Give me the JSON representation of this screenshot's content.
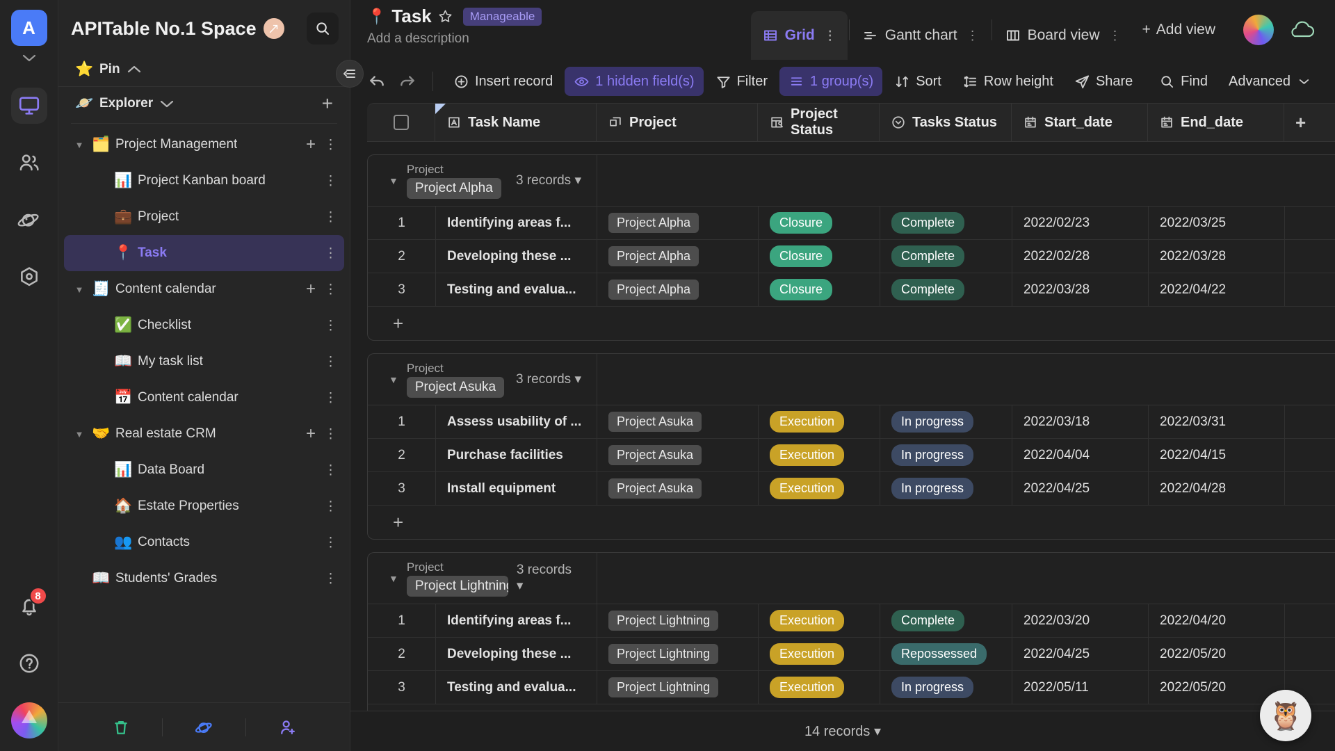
{
  "rail": {
    "workspace_initial": "A",
    "items": [
      {
        "name": "workbench",
        "icon": "monitor-icon",
        "active": true
      },
      {
        "name": "members",
        "icon": "people-icon",
        "active": false
      },
      {
        "name": "template",
        "icon": "planet-icon",
        "active": false
      },
      {
        "name": "widget-center",
        "icon": "hexagon-icon",
        "active": false
      }
    ],
    "notification_count": "8",
    "help_label": "?"
  },
  "sidebar": {
    "space_name": "APITable No.1 Space",
    "space_badge_icon": "pencil-badge-icon",
    "search_icon": "search-icon",
    "pin": {
      "label": "Pin",
      "emoji": "⭐",
      "caret": "chevron-up-icon"
    },
    "explorer": {
      "label": "Explorer",
      "emoji": "🪐",
      "caret": "chevron-down-icon",
      "add_label": "+"
    },
    "tree": [
      {
        "label": "Project Management",
        "emoji": "🗂️",
        "level": 1,
        "expanded": true,
        "selected": false,
        "has_add": true
      },
      {
        "label": "Project Kanban board",
        "emoji": "📊",
        "level": 2,
        "expanded": false,
        "selected": false,
        "has_add": false
      },
      {
        "label": "Project",
        "emoji": "💼",
        "level": 2,
        "expanded": false,
        "selected": false,
        "has_add": false
      },
      {
        "label": "Task",
        "emoji": "📍",
        "level": 2,
        "expanded": false,
        "selected": true,
        "has_add": false
      },
      {
        "label": "Content calendar",
        "emoji": "🧾",
        "level": 1,
        "expanded": true,
        "selected": false,
        "has_add": true
      },
      {
        "label": "Checklist",
        "emoji": "✅",
        "level": 2,
        "expanded": false,
        "selected": false,
        "has_add": false
      },
      {
        "label": "My task list",
        "emoji": "📖",
        "level": 2,
        "expanded": false,
        "selected": false,
        "has_add": false
      },
      {
        "label": "Content calendar",
        "emoji": "📅",
        "level": 2,
        "expanded": false,
        "selected": false,
        "has_add": false
      },
      {
        "label": "Real estate CRM",
        "emoji": "🤝",
        "level": 1,
        "expanded": true,
        "selected": false,
        "has_add": true
      },
      {
        "label": "Data Board",
        "emoji": "📊",
        "level": 2,
        "expanded": false,
        "selected": false,
        "has_add": false
      },
      {
        "label": "Estate Properties",
        "emoji": "🏠",
        "level": 2,
        "expanded": false,
        "selected": false,
        "has_add": false
      },
      {
        "label": "Contacts",
        "emoji": "👥",
        "level": 2,
        "expanded": false,
        "selected": false,
        "has_add": false
      },
      {
        "label": "Students' Grades",
        "emoji": "📖",
        "level": 1,
        "expanded": false,
        "selected": false,
        "has_add": false
      }
    ],
    "footer": [
      {
        "name": "trash-icon",
        "color": "#35c08a"
      },
      {
        "name": "template-planet-icon",
        "color": "#4a7bf7"
      },
      {
        "name": "invite-user-icon",
        "color": "#8b7bf3"
      }
    ],
    "collapse_icon": "collapse-sidebar-icon"
  },
  "header": {
    "datasheet_emoji": "📍",
    "datasheet_name": "Task",
    "star_icon": "star-outline-icon",
    "permission_badge": "Manageable",
    "description_placeholder": "Add a description",
    "views": [
      {
        "label": "Grid",
        "icon": "grid-view-icon",
        "active": true,
        "has_menu": true
      },
      {
        "label": "Gantt chart",
        "icon": "gantt-view-icon",
        "active": false,
        "has_menu": true
      },
      {
        "label": "Board view",
        "icon": "board-view-icon",
        "active": false,
        "has_menu": true
      }
    ],
    "add_view_label": "Add view",
    "add_view_icon": "plus-icon",
    "avatar_name": "user-avatar",
    "cloud_icon": "cloud-sync-icon"
  },
  "toolbar": {
    "undo_icon": "undo-icon",
    "redo_icon": "redo-icon",
    "buttons": [
      {
        "label": "Insert record",
        "icon": "plus-circle-icon",
        "accent": false
      },
      {
        "label": "1 hidden field(s)",
        "icon": "eye-icon",
        "accent": true
      },
      {
        "label": "Filter",
        "icon": "filter-icon",
        "accent": false
      },
      {
        "label": "1 group(s)",
        "icon": "group-icon",
        "accent": true
      },
      {
        "label": "Sort",
        "icon": "sort-icon",
        "accent": false
      },
      {
        "label": "Row height",
        "icon": "row-height-icon",
        "accent": false
      },
      {
        "label": "Share",
        "icon": "share-icon",
        "accent": false
      }
    ],
    "right_buttons": [
      {
        "label": "Find",
        "icon": "search-icon"
      },
      {
        "label": "Advanced",
        "icon": "chevron-down-icon"
      }
    ]
  },
  "grid": {
    "columns": [
      {
        "label": "Task Name",
        "icon": "text-field-icon",
        "cls": "c-name"
      },
      {
        "label": "Project",
        "icon": "link-field-icon",
        "cls": "c-proj"
      },
      {
        "label": "Project Status",
        "icon": "lookup-field-icon",
        "cls": "c-pstat"
      },
      {
        "label": "Tasks Status",
        "icon": "select-field-icon",
        "cls": "c-tstat"
      },
      {
        "label": "Start_date",
        "icon": "date-field-icon",
        "cls": "c-date"
      },
      {
        "label": "End_date",
        "icon": "date-field-icon",
        "cls": "c-date"
      }
    ],
    "add_field_icon": "plus-icon",
    "group_field_label": "Project",
    "add_record_icon": "plus-icon",
    "groups": [
      {
        "value": "Project Alpha",
        "count_label": "3 records",
        "rows": [
          {
            "num": "1",
            "name": "Identifying areas f...",
            "project": "Project Alpha",
            "project_status": "Closure",
            "project_status_color": "#3ba57f",
            "task_status": "Complete",
            "task_status_color": "#2f6050",
            "start_date": "2022/02/23",
            "end_date": "2022/03/25"
          },
          {
            "num": "2",
            "name": "Developing these ...",
            "project": "Project Alpha",
            "project_status": "Closure",
            "project_status_color": "#3ba57f",
            "task_status": "Complete",
            "task_status_color": "#2f6050",
            "start_date": "2022/02/28",
            "end_date": "2022/03/28"
          },
          {
            "num": "3",
            "name": "Testing and evalua...",
            "project": "Project Alpha",
            "project_status": "Closure",
            "project_status_color": "#3ba57f",
            "task_status": "Complete",
            "task_status_color": "#2f6050",
            "start_date": "2022/03/28",
            "end_date": "2022/04/22"
          }
        ]
      },
      {
        "value": "Project Asuka",
        "count_label": "3 records",
        "rows": [
          {
            "num": "1",
            "name": "Assess usability of ...",
            "project": "Project Asuka",
            "project_status": "Execution",
            "project_status_color": "#c9a227",
            "task_status": "In progress",
            "task_status_color": "#3d4a63",
            "start_date": "2022/03/18",
            "end_date": "2022/03/31"
          },
          {
            "num": "2",
            "name": "Purchase facilities",
            "project": "Project Asuka",
            "project_status": "Execution",
            "project_status_color": "#c9a227",
            "task_status": "In progress",
            "task_status_color": "#3d4a63",
            "start_date": "2022/04/04",
            "end_date": "2022/04/15"
          },
          {
            "num": "3",
            "name": "Install equipment",
            "project": "Project Asuka",
            "project_status": "Execution",
            "project_status_color": "#c9a227",
            "task_status": "In progress",
            "task_status_color": "#3d4a63",
            "start_date": "2022/04/25",
            "end_date": "2022/04/28"
          }
        ]
      },
      {
        "value": "Project Lightning",
        "count_label": "3 records",
        "rows": [
          {
            "num": "1",
            "name": "Identifying areas f...",
            "project": "Project Lightning",
            "project_status": "Execution",
            "project_status_color": "#c9a227",
            "task_status": "Complete",
            "task_status_color": "#2f6050",
            "start_date": "2022/03/20",
            "end_date": "2022/04/20"
          },
          {
            "num": "2",
            "name": "Developing these ...",
            "project": "Project Lightning",
            "project_status": "Execution",
            "project_status_color": "#c9a227",
            "task_status": "Repossessed",
            "task_status_color": "#3a6b6b",
            "start_date": "2022/04/25",
            "end_date": "2022/05/20"
          },
          {
            "num": "3",
            "name": "Testing and evalua...",
            "project": "Project Lightning",
            "project_status": "Execution",
            "project_status_color": "#c9a227",
            "task_status": "In progress",
            "task_status_color": "#3d4a63",
            "start_date": "2022/05/11",
            "end_date": "2022/05/20"
          }
        ]
      }
    ]
  },
  "statusbar": {
    "records_label": "14 records",
    "caret_icon": "chevron-down-icon",
    "helper_icon": "owl-assistant-icon",
    "helper_emoji": "🦉"
  }
}
